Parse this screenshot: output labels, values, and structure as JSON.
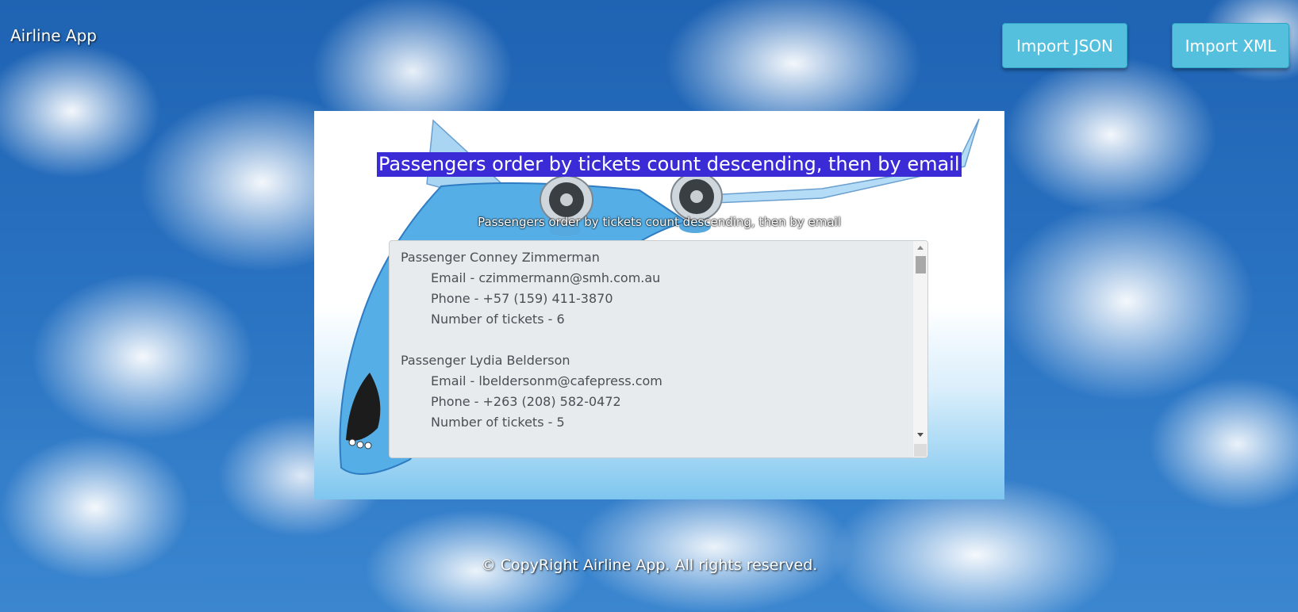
{
  "app": {
    "brand": "Airline App"
  },
  "header": {
    "import_json_label": "Import JSON",
    "import_xml_label": "Import XML"
  },
  "panel": {
    "title": "Passengers order by tickets count descending, then by email",
    "subtitle": "Passengers order by tickets count descending, then by email",
    "passengers": [
      {
        "name": "Passenger Conney  Zimmerman",
        "email": "Email - czimmermann@smh.com.au",
        "phone": "Phone - +57 (159) 411-3870",
        "tickets": "Number of tickets - 6"
      },
      {
        "name": "Passenger Lydia  Belderson",
        "email": "Email - lbeldersonm@cafepress.com",
        "phone": "Phone - +263 (208) 582-0472",
        "tickets": "Number of tickets - 5"
      }
    ]
  },
  "footer": {
    "copyright": "© CopyRight Airline App. All rights reserved."
  },
  "colors": {
    "button": "#54c0de",
    "title_highlight": "#3a2bd6",
    "textbox_bg": "#e8ebee"
  },
  "icons": {
    "scroll_up": "arrow-up-icon",
    "scroll_down": "arrow-down-icon"
  }
}
